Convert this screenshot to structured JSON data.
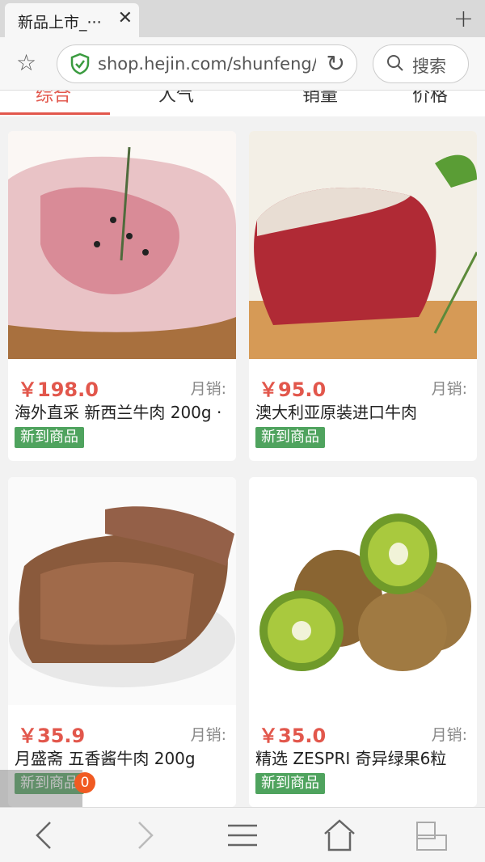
{
  "tab": {
    "title": "新品上市_···",
    "close": "✕",
    "new_tab": "+"
  },
  "address": {
    "url": "shop.hejin.com/shunfeng/···",
    "search_label": "搜索"
  },
  "sort": {
    "items": [
      "综合",
      "人气",
      "销量",
      "价格"
    ]
  },
  "products": [
    {
      "price": "￥198.0",
      "monthly": "月销:",
      "name": "海外直采 新西兰牛肉 200g ·",
      "badge": "新到商品"
    },
    {
      "price": "￥95.0",
      "monthly": "月销:",
      "name": "澳大利亚原装进口牛肉",
      "badge": "新到商品"
    },
    {
      "price": "￥35.9",
      "monthly": "月销:",
      "name": "月盛斋 五香酱牛肉 200g",
      "badge": "新到商品"
    },
    {
      "price": "￥35.0",
      "monthly": "月销:",
      "name": "精选 ZESPRI 奇异绿果6粒",
      "badge": "新到商品"
    }
  ],
  "counter": "0",
  "colors": {
    "accent": "#e2574c",
    "badge": "#4fa35e"
  }
}
